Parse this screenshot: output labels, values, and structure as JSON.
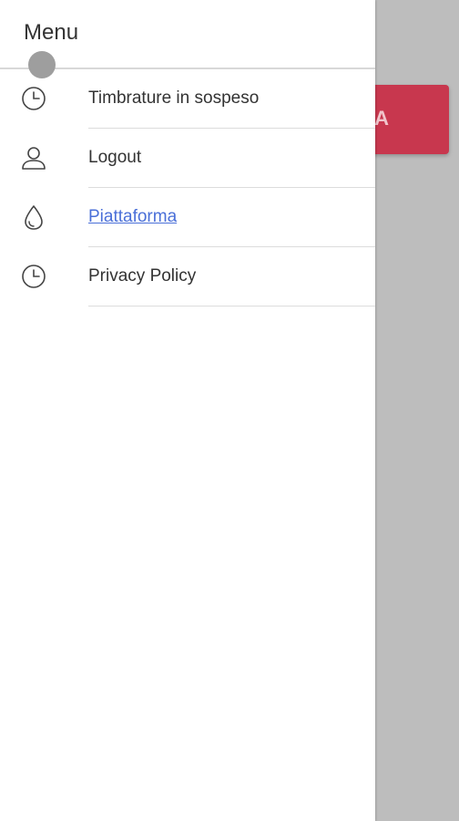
{
  "drawer": {
    "title": "Menu",
    "items": [
      {
        "label": "Timbrature in sospeso",
        "icon": "clock-icon",
        "is_link": false
      },
      {
        "label": "Logout",
        "icon": "user-icon",
        "is_link": false
      },
      {
        "label": "Piattaforma",
        "icon": "water-drop-icon",
        "is_link": true
      },
      {
        "label": "Privacy Policy",
        "icon": "clock-icon",
        "is_link": false
      }
    ]
  },
  "background": {
    "button_label_fragment": "A",
    "button_color": "#c8374e",
    "scrim_color": "#bdbdbd"
  },
  "colors": {
    "link": "#4a6fd8",
    "text": "#333333"
  }
}
